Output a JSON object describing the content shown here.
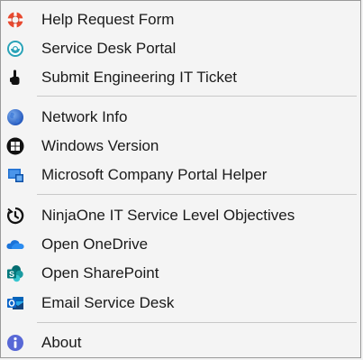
{
  "menu": {
    "items": [
      {
        "label": "Help Request Form",
        "icon": "lifebuoy-icon"
      },
      {
        "label": "Service Desk Portal",
        "icon": "service-desk-icon"
      },
      {
        "label": "Submit Engineering IT Ticket",
        "icon": "hand-icon"
      },
      {
        "label": "Network Info",
        "icon": "globe-icon"
      },
      {
        "label": "Windows Version",
        "icon": "windows-icon"
      },
      {
        "label": "Microsoft Company Portal Helper",
        "icon": "company-portal-icon"
      },
      {
        "label": "NinjaOne IT Service Level Objectives",
        "icon": "ninjaone-icon"
      },
      {
        "label": "Open OneDrive",
        "icon": "onedrive-icon"
      },
      {
        "label": "Open SharePoint",
        "icon": "sharepoint-icon"
      },
      {
        "label": "Email Service Desk",
        "icon": "outlook-icon"
      },
      {
        "label": "About",
        "icon": "info-icon"
      }
    ]
  },
  "colors": {
    "background": "#f4f4f4",
    "separator": "#c8c8c8",
    "text": "#1a1a1a"
  }
}
